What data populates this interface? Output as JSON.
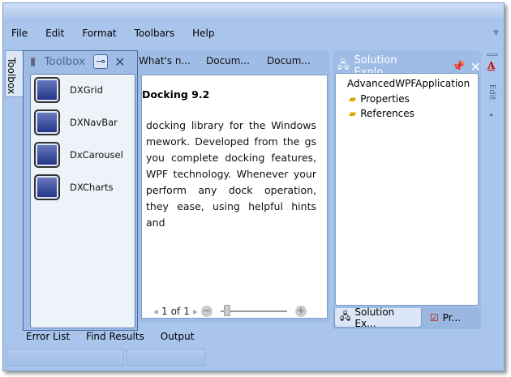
{
  "menu": [
    "File",
    "Edit",
    "Format",
    "Toolbars",
    "Help"
  ],
  "toolbox": {
    "side_tab": "Toolbox",
    "title": "Toolbox",
    "items": [
      "DXGrid",
      "DXNavBar",
      "DxCarousel",
      "DXCharts"
    ]
  },
  "documents": {
    "tabs": [
      "What's n...",
      "Docum...",
      "Docum..."
    ],
    "heading": "Docking 9.2",
    "body": "docking library for the Windows mework. Developed from the gs you complete docking features, WPF technology. Whenever your perform any dock operation, they ease, using helpful hints and",
    "pager": {
      "current": "1",
      "of": "of",
      "total": "1"
    }
  },
  "solution": {
    "title": "Solution Explo...",
    "root": "AdvancedWPFApplication",
    "items": [
      "Properties",
      "References"
    ],
    "tabs": [
      "Solution Ex...",
      "Pr..."
    ]
  },
  "right_strip": {
    "edit": "Edit"
  },
  "bottom_tabs": [
    "Error List",
    "Find Results",
    "Output"
  ]
}
